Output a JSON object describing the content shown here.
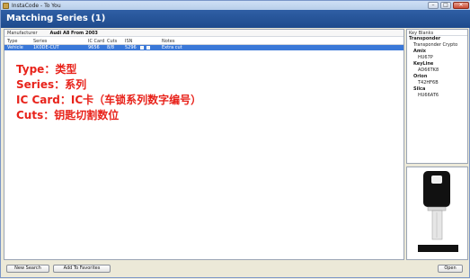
{
  "window": {
    "title": "InstaCode - To You",
    "controls": {
      "minimize": "–",
      "maximize": "□",
      "close": "✕"
    }
  },
  "header": {
    "title": "Matching Series (1)"
  },
  "filter": {
    "label": "Manufacturer",
    "value": "Audi A8 From 2003"
  },
  "table": {
    "columns": [
      "Type",
      "Series",
      "IC Card",
      "Cuts",
      "ISN",
      "Notes"
    ],
    "rows": [
      {
        "type": "Vehicle",
        "series": "1K0DE-CUT",
        "ic_card": "9656",
        "cuts": "8/8",
        "isn": "5296",
        "notes": "Extra cut"
      }
    ]
  },
  "annotations": [
    "Type：类型",
    "Series：系列",
    "IC Card：IC卡（车锁系列数字编号）",
    "Cuts：钥匙切割数位"
  ],
  "key_blanks": {
    "title": "Key Blanks",
    "tree": [
      {
        "label": "Transponder",
        "level": 0,
        "bold": true
      },
      {
        "label": "Transponder Crypto",
        "level": 1,
        "bold": false
      },
      {
        "label": "Amix",
        "level": 1,
        "bold": true
      },
      {
        "label": "HU67P",
        "level": 2,
        "bold": false
      },
      {
        "label": "KeyLine",
        "level": 1,
        "bold": true
      },
      {
        "label": "AD66TK8",
        "level": 2,
        "bold": false
      },
      {
        "label": "Orion",
        "level": 1,
        "bold": true
      },
      {
        "label": "T42HF6B",
        "level": 2,
        "bold": false
      },
      {
        "label": "Silca",
        "level": 1,
        "bold": true
      },
      {
        "label": "HU66AT6",
        "level": 2,
        "bold": false
      }
    ]
  },
  "footer": {
    "new_search": "New Search",
    "add_favorites": "Add To Favorites",
    "open": "Open"
  },
  "colors": {
    "header_band": "#1e4a8c",
    "selection": "#3a78d8",
    "annotation": "#e8231b"
  }
}
